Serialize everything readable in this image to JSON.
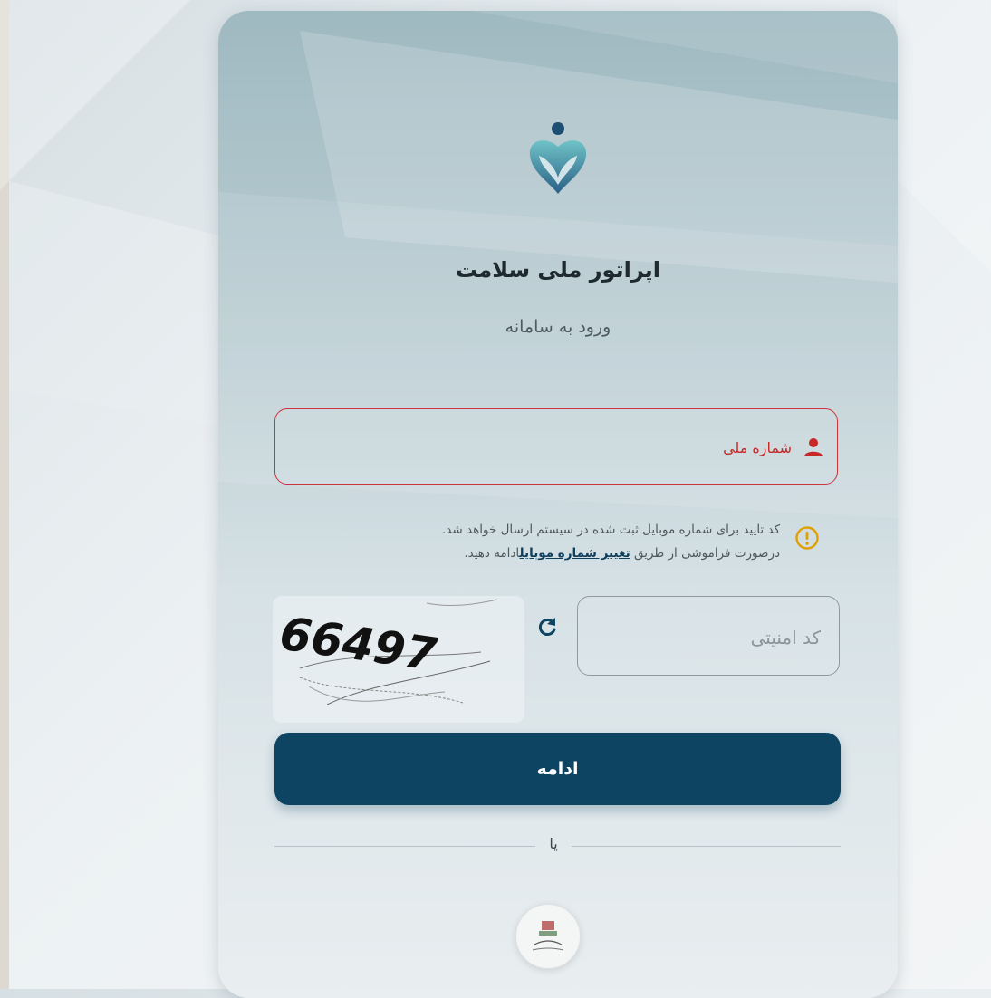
{
  "header": {
    "title": "اپراتور ملی سلامت",
    "subtitle": "ورود به سامانه"
  },
  "login_form": {
    "national_id_placeholder": "شماره ملی",
    "notice_line_1": "کد تایید برای شماره موبایل ثبت شده در سیستم ارسال خواهد شد.",
    "notice_line_2_prefix": "درصورت فراموشی از طریق ",
    "change_mobile_link": "تغییر شماره موبایل",
    "notice_line_2_suffix": "ادامه دهید.",
    "captcha_placeholder": "کد امنیتی",
    "captcha_text": "66497",
    "submit_label": "ادامه",
    "divider_text": "یا"
  },
  "icons": {
    "user": "user-icon",
    "info": "info-icon",
    "refresh": "refresh-icon",
    "logo": "heart-hands-logo"
  },
  "colors": {
    "primary": "#0d4461",
    "error": "#c9353c",
    "warning": "#e0a000"
  }
}
